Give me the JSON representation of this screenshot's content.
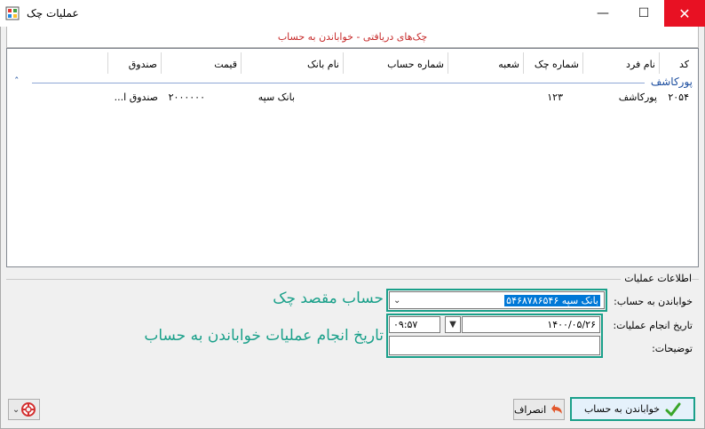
{
  "window": {
    "title": "عملیات چک"
  },
  "header": {
    "caption": "چک‌های دریافتی - خواباندن به حساب"
  },
  "grid": {
    "columns": [
      "کد",
      "نام فرد",
      "شماره چک",
      "شعبه",
      "شماره حساب",
      "نام بانک",
      "قیمت",
      "صندوق"
    ],
    "group": {
      "label": "پورکاشف",
      "toggle": "ˆ"
    },
    "rows": [
      {
        "code": "۲۰۵۴",
        "person": "پورکاشف",
        "check_no": "۱۲۳",
        "branch": "",
        "account_no": "",
        "bank": "بانک سپه",
        "price": "۲۰۰۰۰۰۰",
        "fund": "صندوق ا..."
      }
    ]
  },
  "ops": {
    "title": "اطلاعات عملیات",
    "deposit_label": "خواباندن به حساب:",
    "deposit_value": "بانک سپه ۵۴۶۸۷۸۶۵۴۶",
    "date_label": "تاریخ انجام عملیات:",
    "date_value": "۱۴۰۰/۰۵/۲۶",
    "time_value": "۰۹:۵۷",
    "desc_label": "توضیحات:",
    "annot_account": "حساب مقصد چک",
    "annot_date": "تاریخ انجام عملیات خواباندن به حساب"
  },
  "buttons": {
    "deposit": "خواباندن به حساب",
    "cancel": "انصراف"
  },
  "colors": {
    "accent": "#1aa08a",
    "header_text": "#c62828",
    "group": "#1e4fa0"
  }
}
